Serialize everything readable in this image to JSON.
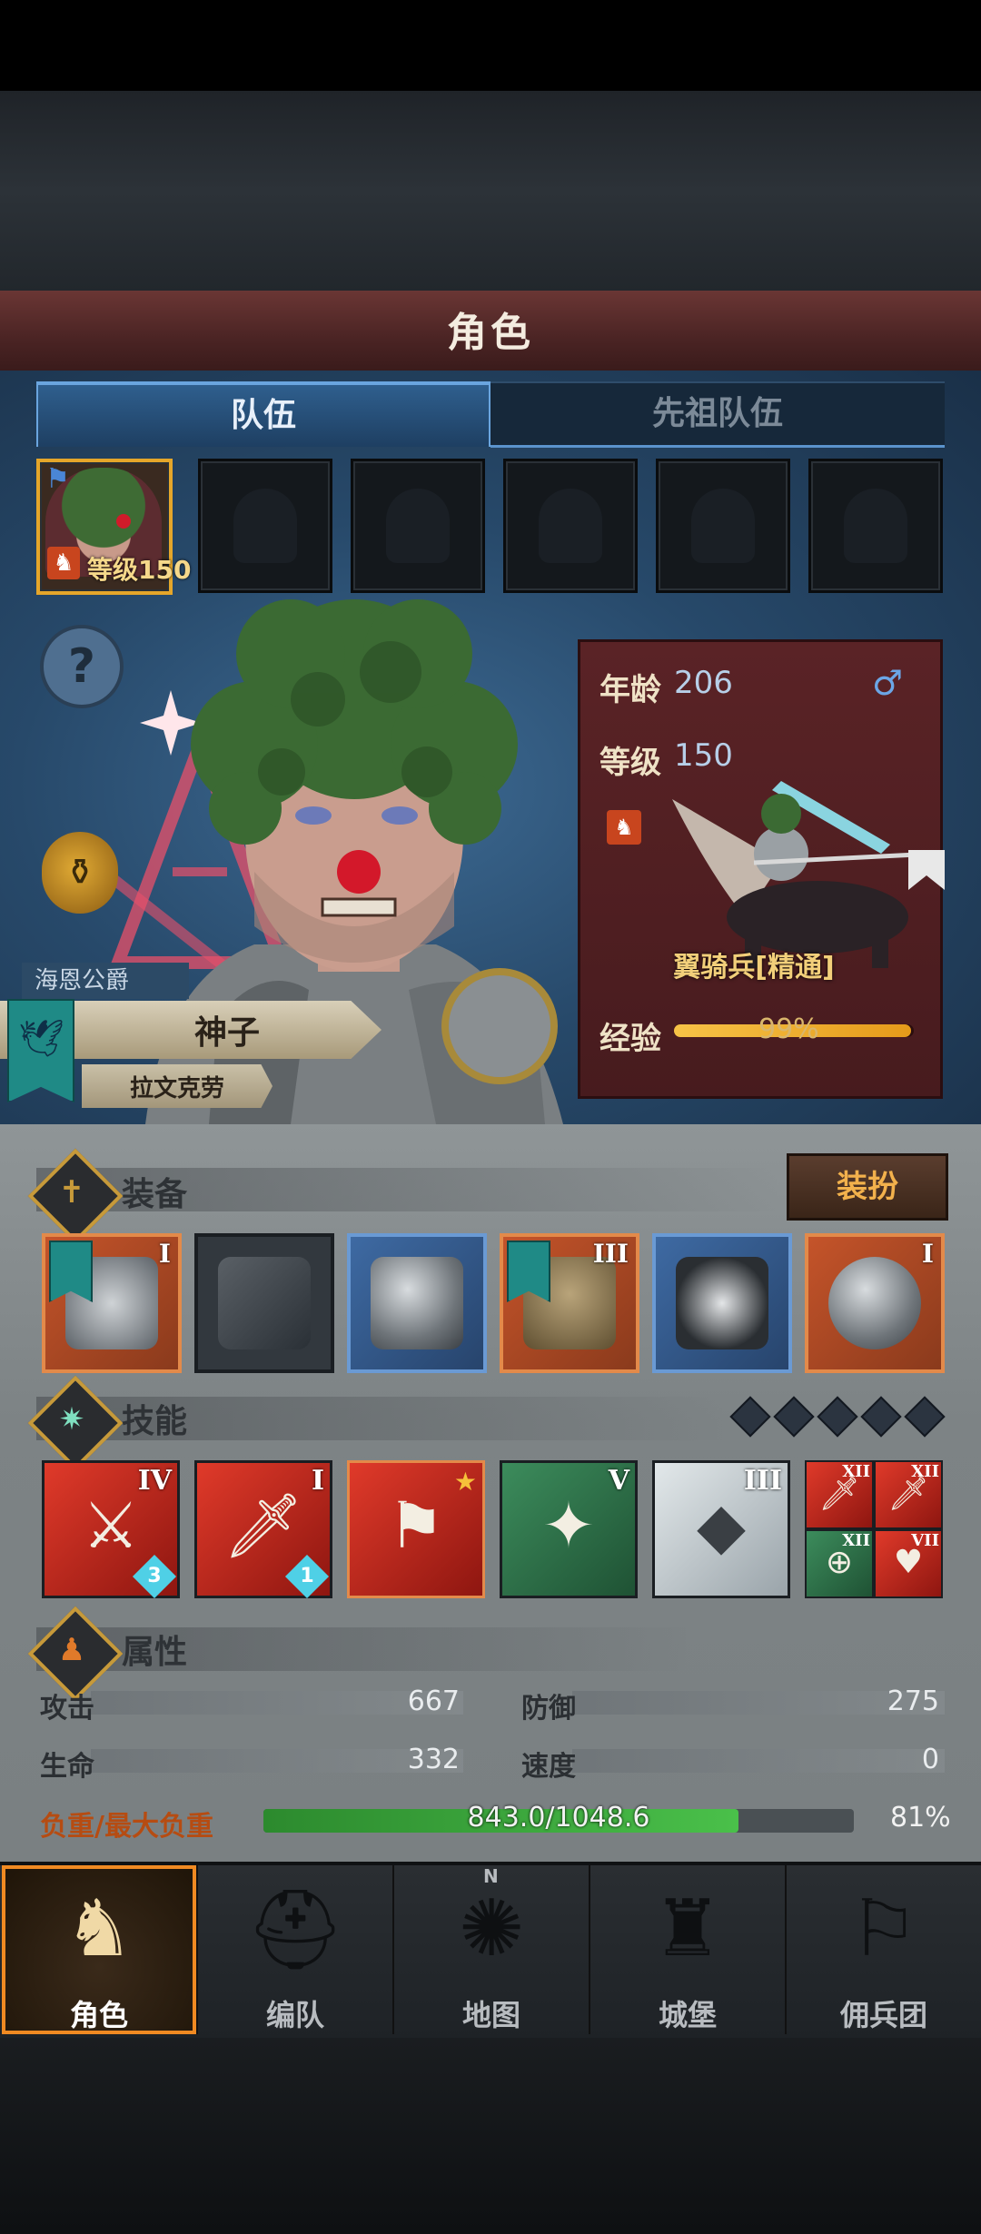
{
  "header": {
    "title": "角色"
  },
  "tabs": [
    {
      "label": "队伍",
      "active": true
    },
    {
      "label": "先祖队伍",
      "active": false
    }
  ],
  "party": {
    "slot1_level": "等级150",
    "filled_slots": 1,
    "total_slots": 6
  },
  "hero": {
    "house_title": "海恩公爵",
    "name": "神子",
    "subname": "拉文克劳"
  },
  "card": {
    "age_label": "年龄",
    "age_value": "206",
    "level_label": "等级",
    "level_value": "150",
    "unit_name": "翼骑兵[精通]",
    "exp_label": "经验",
    "exp_value": "99%",
    "exp_fraction": 0.99
  },
  "equipment": {
    "title": "装备",
    "dress_button": "装扮",
    "items": [
      {
        "rarity": "orange",
        "roman": "I",
        "flag": true
      },
      {
        "rarity": "grey",
        "roman": "",
        "flag": false
      },
      {
        "rarity": "blue",
        "roman": "",
        "flag": false
      },
      {
        "rarity": "orange",
        "roman": "III",
        "flag": true
      },
      {
        "rarity": "blue",
        "roman": "",
        "flag": false
      },
      {
        "rarity": "orange",
        "roman": "I",
        "flag": false
      }
    ]
  },
  "skills": {
    "title": "技能",
    "gem_count": 5,
    "items": [
      {
        "color": "red",
        "roman": "IV",
        "count": "3"
      },
      {
        "color": "red",
        "roman": "I",
        "count": "1"
      },
      {
        "color": "red",
        "roman": "",
        "star": true
      },
      {
        "color": "green",
        "roman": "V"
      },
      {
        "color": "white",
        "roman": "III"
      }
    ],
    "mini": [
      {
        "color": "red",
        "roman": "XII"
      },
      {
        "color": "red",
        "roman": "XII"
      },
      {
        "color": "green",
        "roman": "XII"
      },
      {
        "color": "red",
        "roman": "VII"
      }
    ]
  },
  "attributes": {
    "title": "属性",
    "attack_label": "攻击",
    "attack_value": "667",
    "defense_label": "防御",
    "defense_value": "275",
    "life_label": "生命",
    "life_value": "332",
    "speed_label": "速度",
    "speed_value": "0",
    "load_label": "负重/最大负重",
    "load_text": "843.0/1048.6",
    "load_percent": "81%",
    "load_fraction": 0.804
  },
  "nav": [
    {
      "label": "角色",
      "active": true,
      "icon": "knight-icon"
    },
    {
      "label": "编队",
      "active": false,
      "icon": "helmet-icon"
    },
    {
      "label": "地图",
      "active": false,
      "icon": "compass-icon"
    },
    {
      "label": "城堡",
      "active": false,
      "icon": "castle-icon"
    },
    {
      "label": "佣兵团",
      "active": false,
      "icon": "banner-icon"
    }
  ],
  "compass_letter": "N",
  "colors": {
    "accent_orange": "#f08a22",
    "tab_blue": "#2f5f8e",
    "card_red": "#5a2326"
  }
}
